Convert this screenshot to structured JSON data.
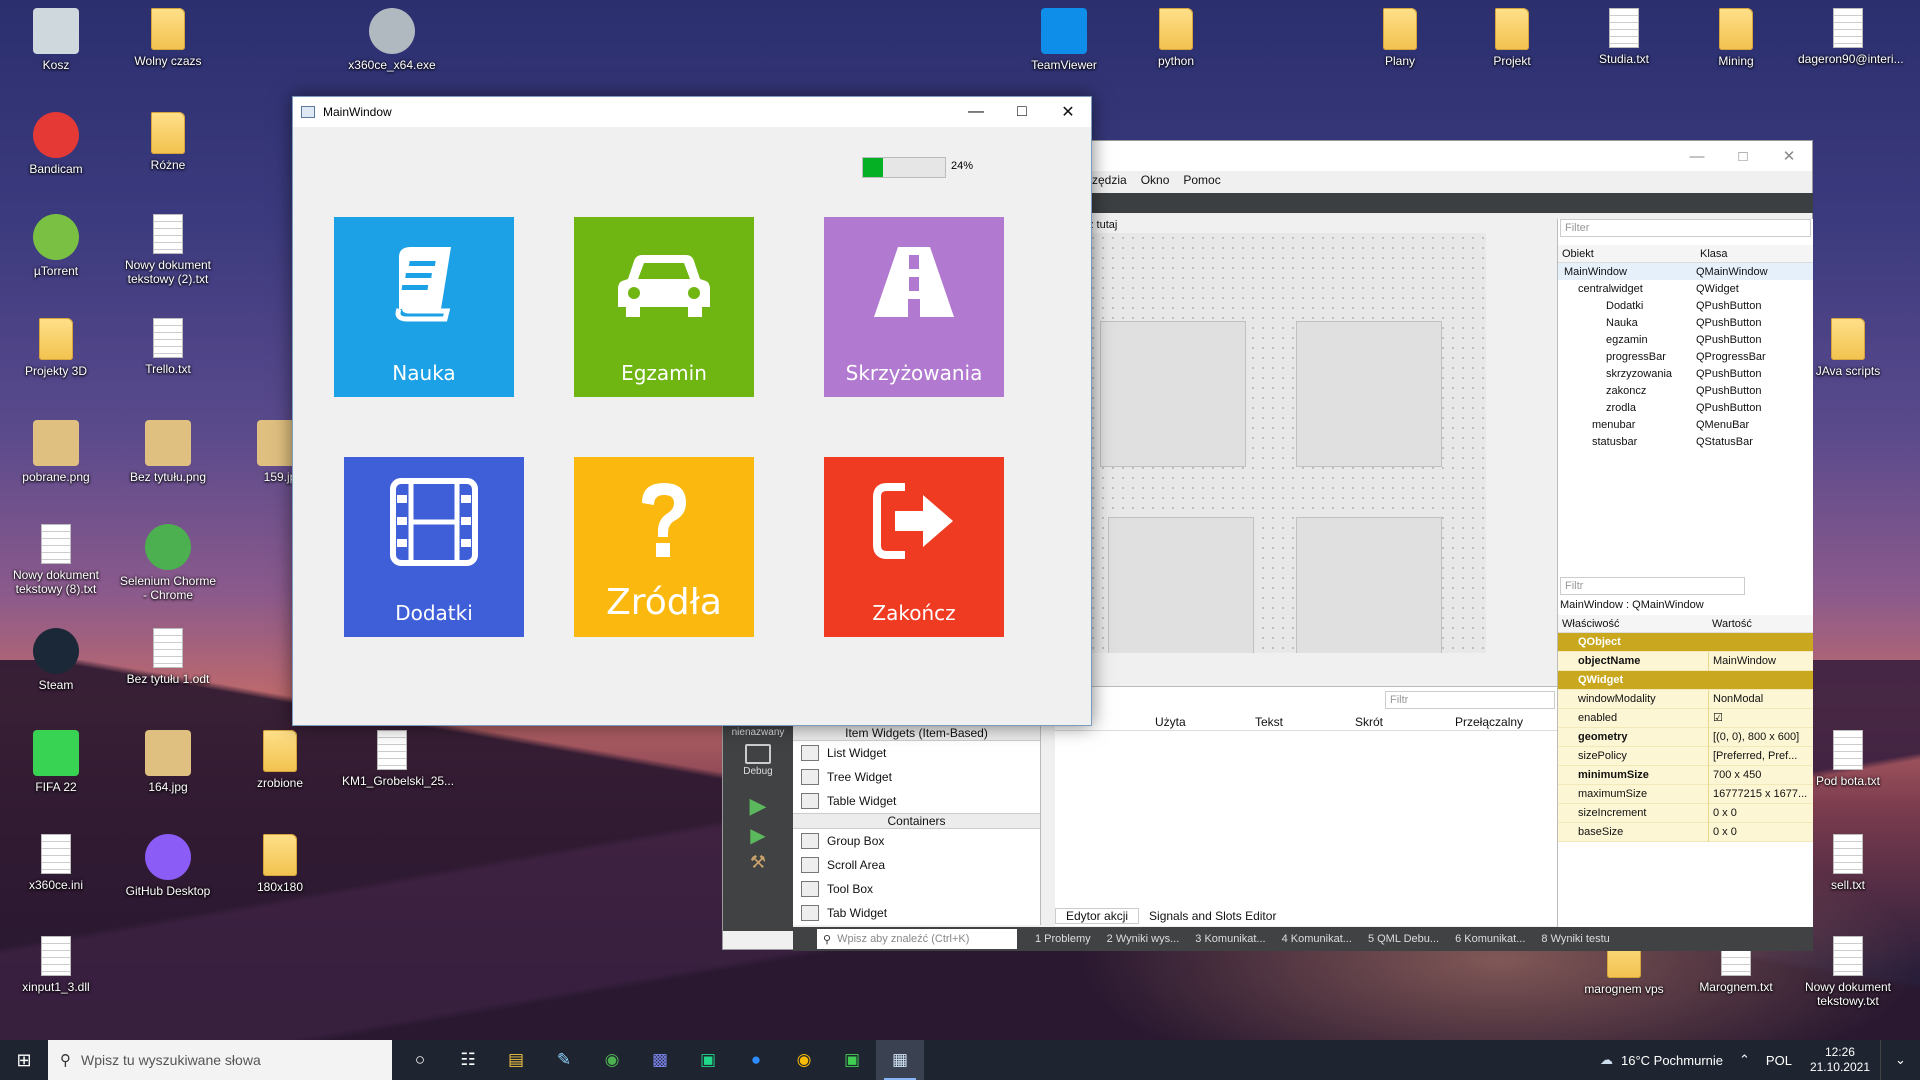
{
  "desktop": {
    "icons": [
      {
        "label": "Kosz",
        "icon": "recycle-bin-icon"
      },
      {
        "label": "Wolny czazs",
        "icon": "folder-icon"
      },
      {
        "label": "x360ce_x64.exe",
        "icon": "gamepad-icon"
      },
      {
        "label": "TeamViewer",
        "icon": "teamviewer-icon"
      },
      {
        "label": "python",
        "icon": "folder-icon"
      },
      {
        "label": "Plany",
        "icon": "folder-icon"
      },
      {
        "label": "Projekt",
        "icon": "folder-icon"
      },
      {
        "label": "Studia.txt",
        "icon": "text-file-icon"
      },
      {
        "label": "Mining",
        "icon": "folder-icon"
      },
      {
        "label": "dageron90@interi...",
        "icon": "text-file-icon"
      },
      {
        "label": "Bandicam",
        "icon": "bandicam-icon"
      },
      {
        "label": "Różne",
        "icon": "folder-icon"
      },
      {
        "label": "µTorrent",
        "icon": "utorrent-icon"
      },
      {
        "label": "Nowy dokument tekstowy (2).txt",
        "icon": "text-file-icon"
      },
      {
        "label": "Projekty 3D",
        "icon": "folder-icon"
      },
      {
        "label": "Trello.txt",
        "icon": "text-file-icon"
      },
      {
        "label": "JAva scripts",
        "icon": "folder-icon"
      },
      {
        "label": "pobrane.png",
        "icon": "image-file-icon"
      },
      {
        "label": "Bez tytułu.png",
        "icon": "image-file-icon"
      },
      {
        "label": "159.jp",
        "icon": "image-file-icon"
      },
      {
        "label": "Nowy dokument tekstowy (8).txt",
        "icon": "text-file-icon"
      },
      {
        "label": "Selenium Chorme - Chrome",
        "icon": "chrome-icon"
      },
      {
        "label": "Steam",
        "icon": "steam-icon"
      },
      {
        "label": "Bez tytułu 1.odt",
        "icon": "document-file-icon"
      },
      {
        "label": "FIFA 22",
        "icon": "fifa-icon"
      },
      {
        "label": "164.jpg",
        "icon": "image-file-icon"
      },
      {
        "label": "zrobione",
        "icon": "folder-icon"
      },
      {
        "label": "KM1_Grobelski_25...",
        "icon": "document-file-icon"
      },
      {
        "label": "Pod bota.txt",
        "icon": "text-file-icon"
      },
      {
        "label": "x360ce.ini",
        "icon": "settings-file-icon"
      },
      {
        "label": "GitHub Desktop",
        "icon": "github-icon"
      },
      {
        "label": "180x180",
        "icon": "folder-icon"
      },
      {
        "label": "sell.txt",
        "icon": "text-file-icon"
      },
      {
        "label": "xinput1_3.dll",
        "icon": "settings-file-icon"
      },
      {
        "label": "marognem vps",
        "icon": "folder-icon"
      },
      {
        "label": "Marognem.txt",
        "icon": "text-file-icon"
      },
      {
        "label": "Nowy dokument tekstowy.txt",
        "icon": "text-file-icon"
      }
    ]
  },
  "main_window": {
    "title": "MainWindow",
    "progress": {
      "value_percent": 24,
      "label": "24%"
    },
    "tiles": [
      {
        "label": "Nauka",
        "color": "#1da1e6",
        "icon": "book-icon"
      },
      {
        "label": "Egzamin",
        "color": "#6fb612",
        "icon": "car-icon"
      },
      {
        "label": "Skrzyżowania",
        "color": "#b17ad0",
        "icon": "road-icon"
      },
      {
        "label": "Dodatki",
        "color": "#3f5fd9",
        "icon": "film-icon"
      },
      {
        "label": "Zródła",
        "color": "#fbb90f",
        "icon": "question-icon"
      },
      {
        "label": "Zakończ",
        "color": "#ef3b21",
        "icon": "exit-icon"
      }
    ]
  },
  "qt_creator": {
    "menu": [
      "rzędzia",
      "Okno",
      "Pomoc"
    ],
    "form_hint": "z tutaj",
    "object_filter_placeholder": "Filter",
    "object_headers": {
      "object": "Obiekt",
      "class": "Klasa"
    },
    "objects": [
      {
        "name": "MainWindow",
        "class": "QMainWindow"
      },
      {
        "name": "centralwidget",
        "class": "QWidget"
      },
      {
        "name": "Dodatki",
        "class": "QPushButton"
      },
      {
        "name": "Nauka",
        "class": "QPushButton"
      },
      {
        "name": "egzamin",
        "class": "QPushButton"
      },
      {
        "name": "progressBar",
        "class": "QProgressBar"
      },
      {
        "name": "skrzyzowania",
        "class": "QPushButton"
      },
      {
        "name": "zakoncz",
        "class": "QPushButton"
      },
      {
        "name": "zrodla",
        "class": "QPushButton"
      },
      {
        "name": "menubar",
        "class": "QMenuBar"
      },
      {
        "name": "statusbar",
        "class": "QStatusBar"
      }
    ],
    "prop_filter_placeholder": "Filtr",
    "prop_context": "MainWindow : QMainWindow",
    "prop_headers": {
      "property": "Właściwość",
      "value": "Wartość"
    },
    "properties": [
      {
        "name": "QObject",
        "value": "",
        "group": true
      },
      {
        "name": "objectName",
        "value": "MainWindow"
      },
      {
        "name": "QWidget",
        "value": "",
        "group": true
      },
      {
        "name": "windowModality",
        "value": "NonModal"
      },
      {
        "name": "enabled",
        "value": "☑"
      },
      {
        "name": "geometry",
        "value": "[(0, 0), 800 x 600]"
      },
      {
        "name": "sizePolicy",
        "value": "[Preferred, Pref..."
      },
      {
        "name": "minimumSize",
        "value": "700 x 450"
      },
      {
        "name": "maximumSize",
        "value": "16777215 x 1677..."
      },
      {
        "name": "sizeIncrement",
        "value": "0 x 0"
      },
      {
        "name": "baseSize",
        "value": "0 x 0"
      }
    ],
    "side_labels": {
      "project": "nienazwany",
      "mode": "Debug"
    },
    "widget_box_items": [
      {
        "label": "Item Widgets (Item-Based)",
        "type": "category"
      },
      {
        "label": "List Widget",
        "type": "item"
      },
      {
        "label": "Tree Widget",
        "type": "item"
      },
      {
        "label": "Table Widget",
        "type": "item"
      },
      {
        "label": "Containers",
        "type": "category"
      },
      {
        "label": "Group Box",
        "type": "item"
      },
      {
        "label": "Scroll Area",
        "type": "item"
      },
      {
        "label": "Tool Box",
        "type": "item"
      },
      {
        "label": "Tab Widget",
        "type": "item"
      }
    ],
    "actions_filter_placeholder": "Filtr",
    "action_headers": [
      "Użyta",
      "Tekst",
      "Skrót",
      "Przełączalny"
    ],
    "action_tabs": [
      "Edytor akcji",
      "Signals and Slots Editor"
    ],
    "status_search_placeholder": "Wpisz aby znaleźć (Ctrl+K)",
    "status_items": [
      "1 Problemy",
      "2 Wyniki wys...",
      "3 Komunikat...",
      "4 Komunikat...",
      "5 QML Debu...",
      "6 Komunikat...",
      "8 Wyniki testu"
    ]
  },
  "taskbar": {
    "search_placeholder": "Wpisz tu wyszukiwane słowa",
    "weather": "16°C Pochmurnie",
    "language": "POL",
    "time": "12:26",
    "date": "21.10.2021"
  }
}
